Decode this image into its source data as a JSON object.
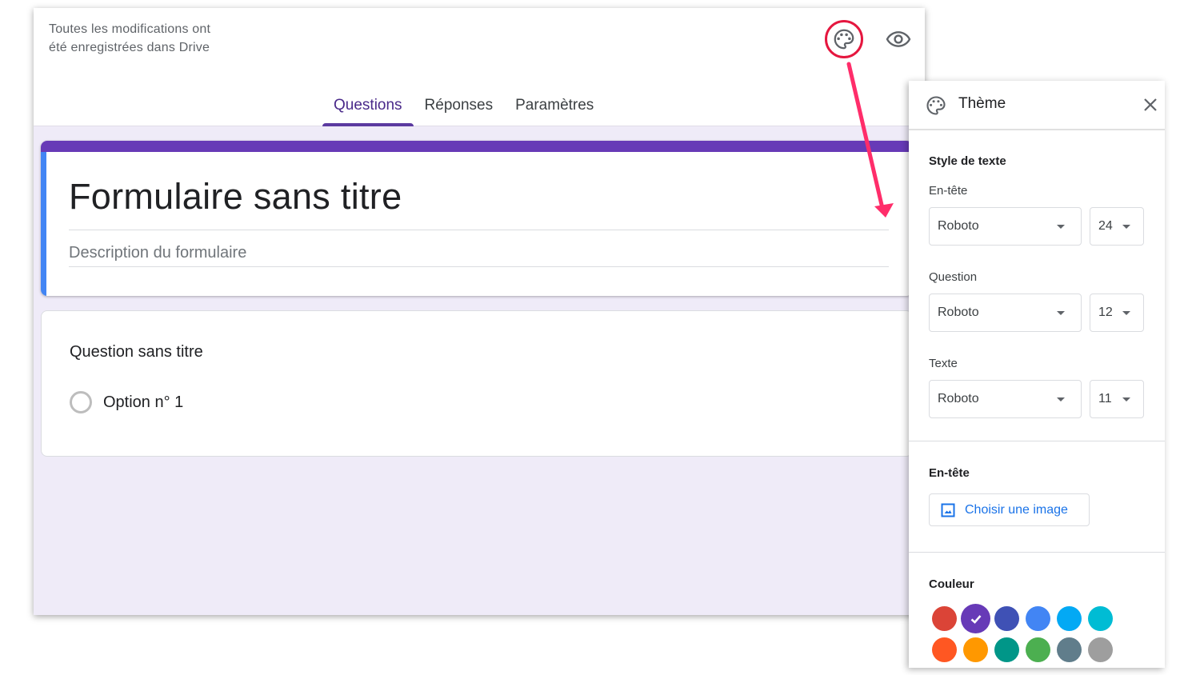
{
  "header": {
    "save_status": "Toutes les modifications ont été enregistrées dans Drive",
    "palette_button": "palette-icon",
    "preview_button": "eye-icon"
  },
  "tabs": [
    {
      "label": "Questions",
      "active": true
    },
    {
      "label": "Réponses",
      "active": false
    },
    {
      "label": "Paramètres",
      "active": false
    }
  ],
  "form": {
    "title": "Formulaire sans titre",
    "description_placeholder": "Description du formulaire",
    "header_color": "#673ab7",
    "accent_color": "#4285f4"
  },
  "question": {
    "title": "Question sans titre",
    "options": [
      "Option n° 1"
    ]
  },
  "annotation": {
    "highlight_color": "#e5173f",
    "arrow_color": "#ff2d6a"
  },
  "theme_panel": {
    "title": "Thème",
    "text_style_section": "Style de texte",
    "header_label": "En-tête",
    "header_font": "Roboto",
    "header_size": "24",
    "question_label": "Question",
    "question_font": "Roboto",
    "question_size": "12",
    "text_label": "Texte",
    "text_font": "Roboto",
    "text_size": "11",
    "header_section": "En-tête",
    "choose_image_label": "Choisir une image",
    "color_section": "Couleur",
    "colors": [
      {
        "hex": "#db4437",
        "selected": false
      },
      {
        "hex": "#673ab7",
        "selected": true
      },
      {
        "hex": "#3f51b5",
        "selected": false
      },
      {
        "hex": "#4285f4",
        "selected": false
      },
      {
        "hex": "#03a9f4",
        "selected": false
      },
      {
        "hex": "#00bcd4",
        "selected": false
      },
      {
        "hex": "#ff5722",
        "selected": false
      },
      {
        "hex": "#ff9800",
        "selected": false
      },
      {
        "hex": "#009688",
        "selected": false
      },
      {
        "hex": "#4caf50",
        "selected": false
      },
      {
        "hex": "#607d8b",
        "selected": false
      },
      {
        "hex": "#9e9e9e",
        "selected": false
      }
    ]
  }
}
